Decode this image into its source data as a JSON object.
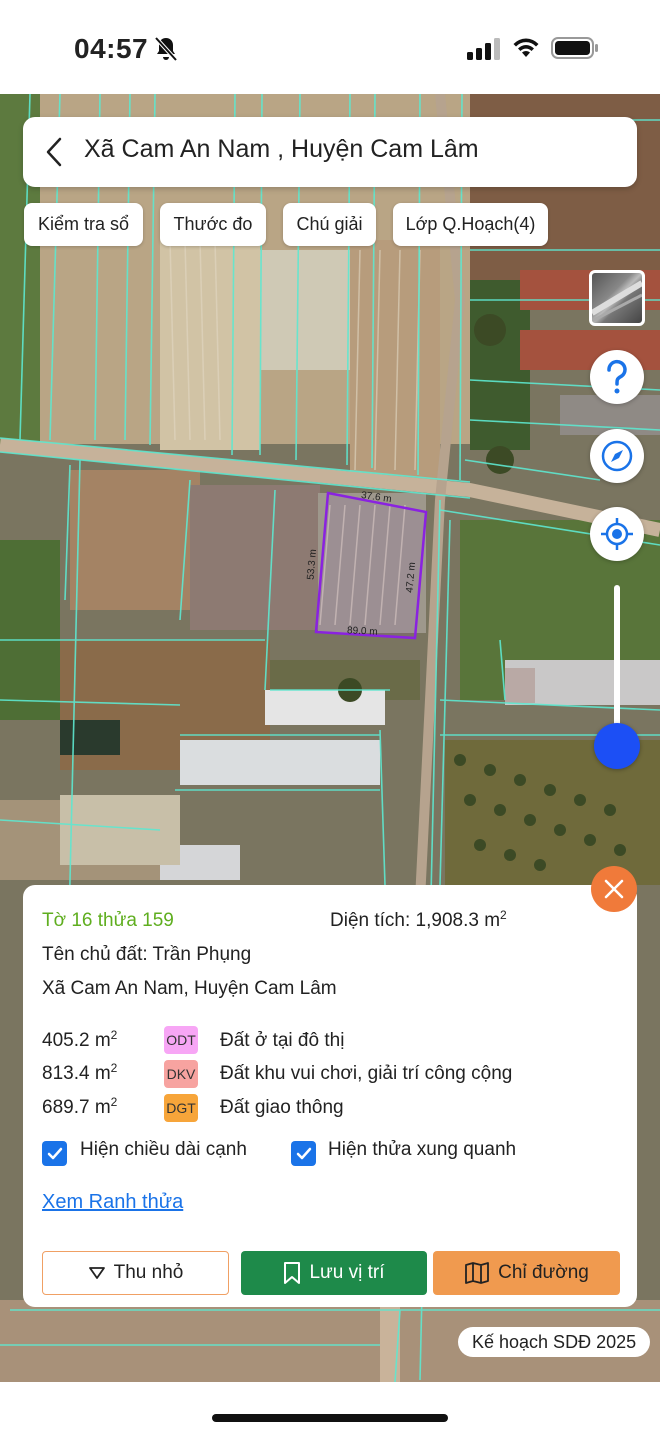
{
  "status_bar": {
    "time": "04:57"
  },
  "search": {
    "title": "Xã Cam An Nam , Huyện Cam Lâm"
  },
  "chips": [
    "Kiểm tra sổ",
    "Thước đo",
    "Chú giải",
    "Lớp Q.Hoạch(4)"
  ],
  "map": {
    "edge_top": "37.6 m",
    "edge_left": "53.3 m",
    "edge_right": "47.2 m",
    "edge_bottom": "89.0 m",
    "zoom_level": 0.1,
    "plan_label": "Kế hoạch SDĐ 2025"
  },
  "panel": {
    "parcel_id": "Tờ 16 thửa 159",
    "area_label": "Diện tích: 1,908.3 m",
    "area_sup": "2",
    "owner": "Tên chủ đất: Trần Phụng",
    "address": "Xã Cam An Nam, Huyện Cam Lâm",
    "land_uses": [
      {
        "area": "405.2 m",
        "sup": "2",
        "code": "ODT",
        "desc": "Đất ở tại đô thị",
        "color": "#f7a6f5"
      },
      {
        "area": "813.4 m",
        "sup": "2",
        "code": "DKV",
        "desc": "Đất khu vui chơi, giải trí công cộng",
        "color": "#f7a3a0"
      },
      {
        "area": "689.7 m",
        "sup": "2",
        "code": "DGT",
        "desc": "Đất giao thông",
        "color": "#f7a53a"
      }
    ],
    "check_edges": "Hiện chiều dài cạnh",
    "check_neighbors": "Hiện thửa xung quanh",
    "boundary_link": "Xem Ranh thửa",
    "btn_collapse": "Thu nhỏ",
    "btn_save": "Lưu vị trí",
    "btn_route": "Chỉ đường"
  },
  "colors": {
    "accent_blue": "#1a73e8",
    "parcel_outline": "#8a22e0",
    "parcel_lines": "#5ee8d0",
    "save_green": "#1e8a4a",
    "route_orange": "#f09a4f",
    "close_orange": "#f07a3a"
  }
}
